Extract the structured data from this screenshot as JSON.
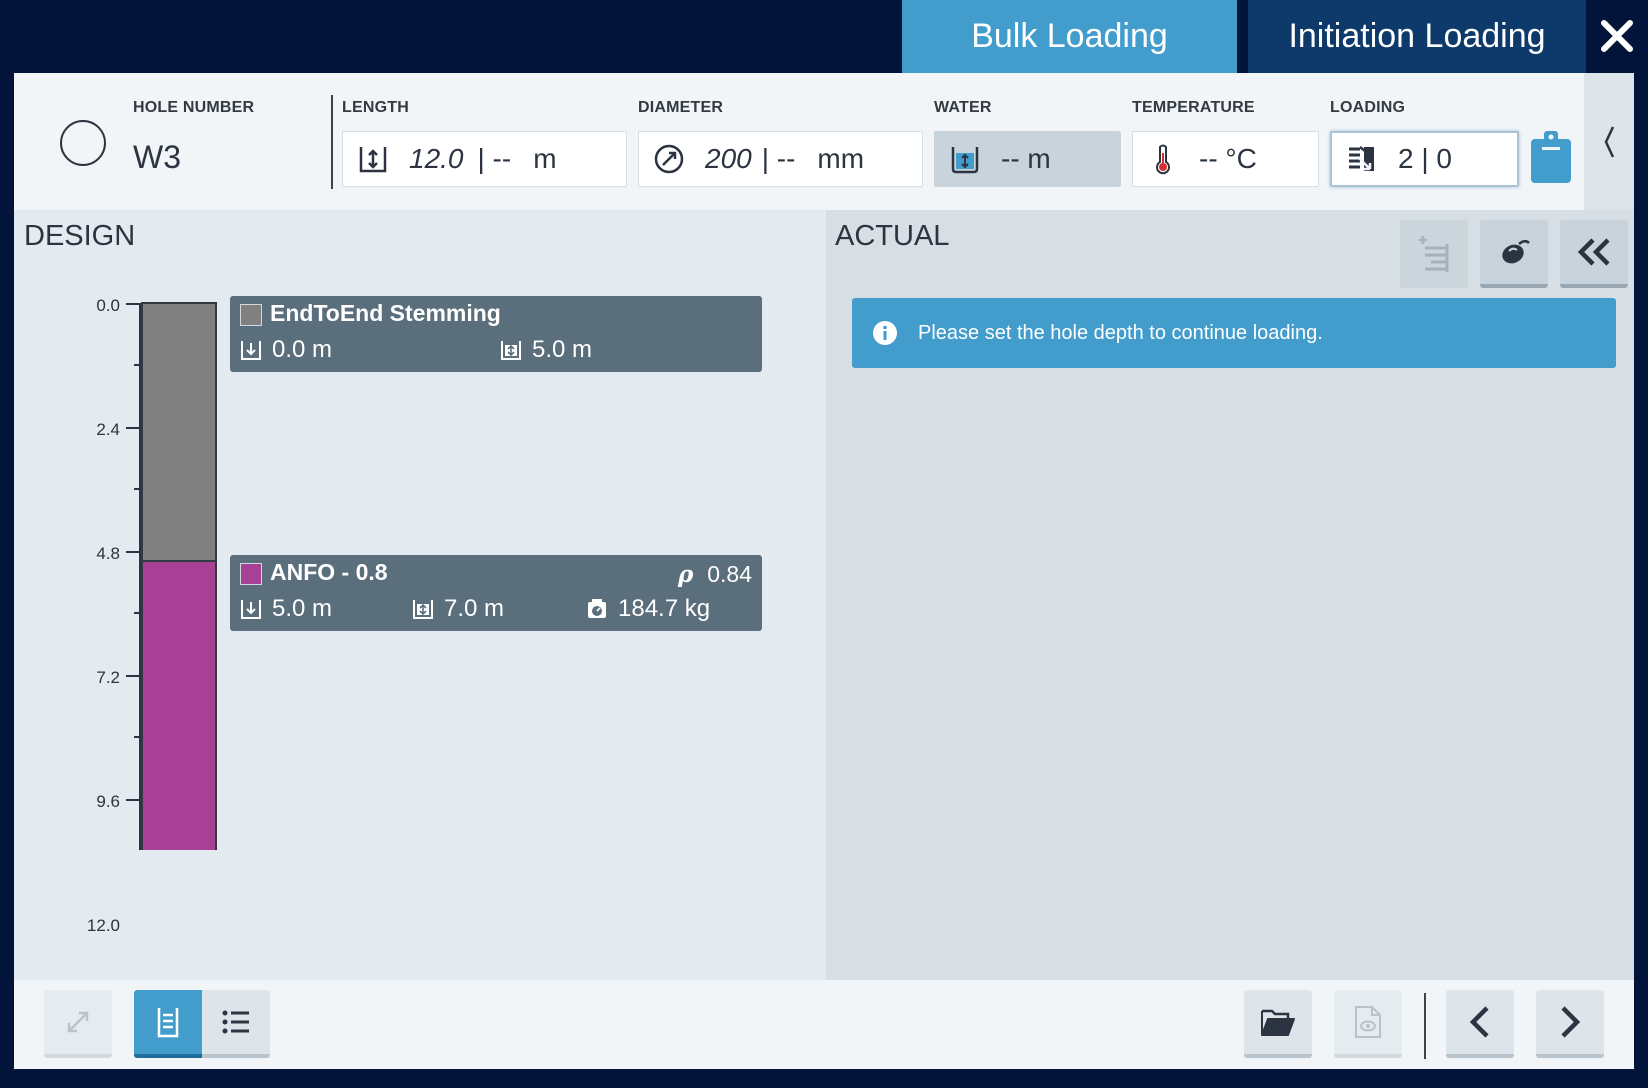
{
  "tabs": {
    "bulk_loading": "Bulk Loading",
    "initiation_loading": "Initiation Loading"
  },
  "header": {
    "hole_number_label": "HOLE NUMBER",
    "hole_number_value": "W3",
    "length_label": "LENGTH",
    "length_value": "12.0",
    "length_actual": "|  --",
    "length_unit": "m",
    "diameter_label": "DIAMETER",
    "diameter_value": "200",
    "diameter_actual": "| --",
    "diameter_unit": "mm",
    "water_label": "WATER",
    "water_value": "-- m",
    "temperature_label": "TEMPERATURE",
    "temperature_value": "-- °C",
    "loading_label": "LOADING",
    "loading_value": "2 | 0"
  },
  "design": {
    "title": "DESIGN",
    "scale_ticks": [
      "0.0",
      "2.4",
      "4.8",
      "7.2",
      "9.6",
      "12.0"
    ],
    "hole_depth_max": 12.0,
    "layers": [
      {
        "name": "EndToEnd Stemming",
        "color": "#808080",
        "top": "0.0 m",
        "length": "5.0 m",
        "top_value": 0.0,
        "length_value": 5.0
      },
      {
        "name": "ANFO - 0.8",
        "color": "#a84196",
        "top": "5.0 m",
        "length": "7.0 m",
        "mass": "184.7 kg",
        "density": "0.84",
        "top_value": 5.0,
        "length_value": 7.0
      }
    ]
  },
  "actual": {
    "title": "ACTUAL",
    "info_message": "Please set the hole depth to continue loading."
  },
  "colors": {
    "accent": "#429dcc",
    "navy": "#02143a",
    "stemming": "#808080",
    "anfo": "#a84196",
    "card": "#5a6e7c"
  }
}
